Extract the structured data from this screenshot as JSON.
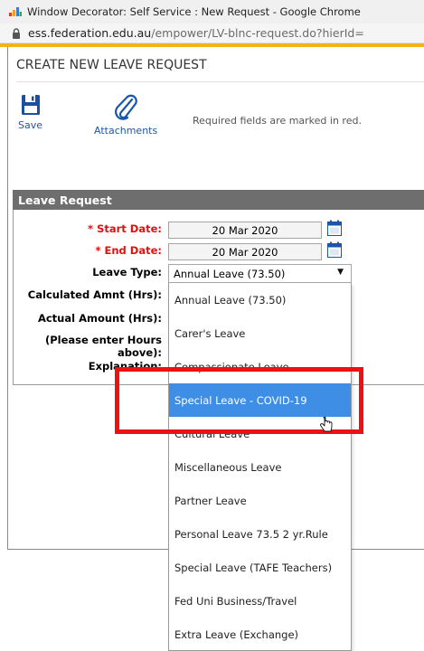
{
  "browser": {
    "window_title": "Window Decorator: Self Service : New Request - Google Chrome",
    "url_host": "ess.federation.edu.au",
    "url_path": "/empower/LV-blnc-request.do?hierId="
  },
  "page": {
    "title": "CREATE NEW LEAVE REQUEST",
    "required_note": "Required fields are marked in red.",
    "toolbar": {
      "save_label": "Save",
      "attachments_label": "Attachments"
    }
  },
  "leave_request": {
    "section_title": "Leave Request",
    "fields": {
      "start_date_star": "* ",
      "start_date_label": "Start Date:",
      "start_date_value": "20 Mar 2020",
      "end_date_star": "* ",
      "end_date_label": "End Date:",
      "end_date_value": "20 Mar 2020",
      "leave_type_label": "Leave Type:",
      "leave_type_value": "Annual Leave (73.50)",
      "calculated_amount_label": "Calculated Amnt (Hrs):",
      "actual_amount_label": "Actual Amount (Hrs):",
      "hours_hint_line1": "(Please enter Hours",
      "hours_hint_line2": "above):",
      "explanation_label": "Explanation:"
    },
    "leave_type_options": [
      "Annual Leave (73.50)",
      "Carer's Leave",
      "Compassionate Leave",
      "Special Leave - COVID-19",
      "Cultural Leave",
      "Miscellaneous Leave",
      "Partner Leave",
      "Personal Leave 73.5 2 yr.Rule",
      "Special Leave (TAFE Teachers)",
      "Fed Uni Business/Travel",
      "Extra Leave (Exchange)"
    ],
    "highlighted_option": "Special Leave - COVID-19"
  },
  "colors": {
    "accent_bar": "#f2b21a",
    "section_bar": "#6e6e6e",
    "required_red": "#e01010",
    "selected_blue": "#3f8ee6",
    "highlight_red": "#ee1111",
    "link_blue": "#1b57a8"
  },
  "icons": {
    "app": "window-decorator-icon",
    "lock": "lock-icon",
    "save": "floppy-disk-icon",
    "attachments": "paperclip-icon",
    "calendar": "calendar-icon",
    "dropdown": "chevron-down-icon",
    "cursor": "hand-pointer-icon"
  }
}
